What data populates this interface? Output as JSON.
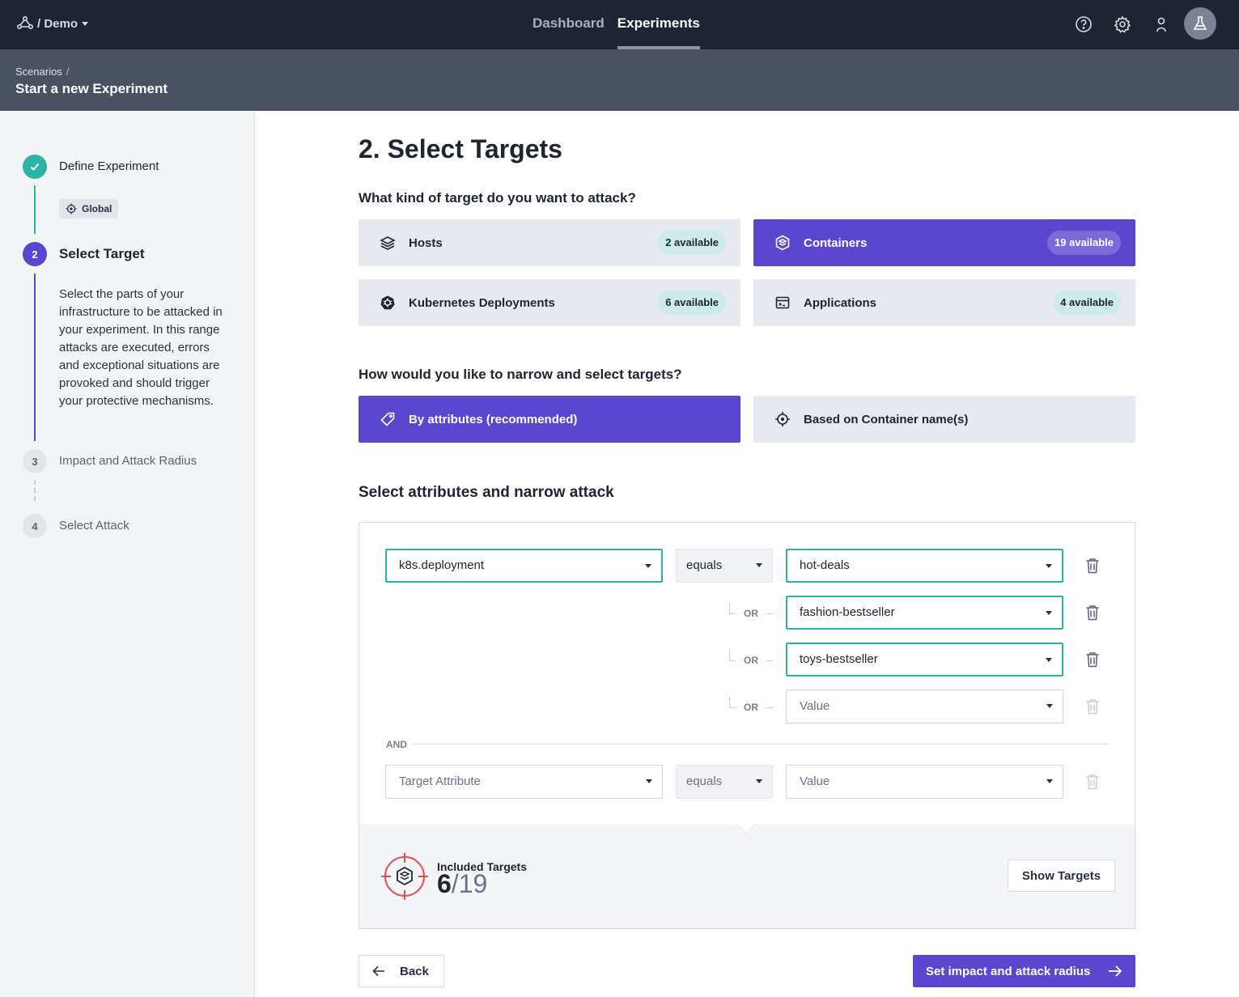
{
  "header": {
    "workspace": "/ Demo",
    "nav": [
      {
        "label": "Dashboard",
        "active": false
      },
      {
        "label": "Experiments",
        "active": true
      }
    ],
    "icons": [
      "help-icon",
      "settings-icon",
      "user-icon",
      "flask-icon"
    ]
  },
  "subheader": {
    "breadcrumb": "Scenarios",
    "breadcrumb_sep": "/",
    "title": "Start a new Experiment"
  },
  "sidebar": {
    "steps": [
      {
        "number": "",
        "label": "Define Experiment",
        "state": "done"
      },
      {
        "number": "2",
        "label": "Select Target",
        "state": "active"
      },
      {
        "number": "3",
        "label": "Impact and Attack Radius",
        "state": "pending"
      },
      {
        "number": "4",
        "label": "Select Attack",
        "state": "pending"
      }
    ],
    "global_tag": "Global",
    "description": "Select the parts of your infrastructure to be attacked in your experiment. In this range attacks are executed, errors and exceptional situations are provoked and should trigger your protective mechanisms."
  },
  "main": {
    "title": "2. Select Targets",
    "target_question": "What kind of target do you want to attack?",
    "target_types": [
      {
        "label": "Hosts",
        "badge": "2 available",
        "icon": "layers-icon",
        "selected": false
      },
      {
        "label": "Containers",
        "badge": "19 available",
        "icon": "container-icon",
        "selected": true
      },
      {
        "label": "Kubernetes Deployments",
        "badge": "6 available",
        "icon": "kubernetes-icon",
        "selected": false
      },
      {
        "label": "Applications",
        "badge": "4 available",
        "icon": "application-icon",
        "selected": false
      }
    ],
    "narrow_question": "How would you like to narrow and select targets?",
    "narrow_options": [
      {
        "label": "By attributes (recommended)",
        "icon": "tag-icon",
        "selected": true
      },
      {
        "label": "Based on Container name(s)",
        "icon": "crosshair-icon",
        "selected": false
      }
    ],
    "attributes_heading": "Select attributes and narrow attack",
    "conditions": {
      "first_attribute": "k8s.deployment",
      "first_operator": "equals",
      "values": [
        "hot-deals",
        "fashion-bestseller",
        "toys-bestseller"
      ],
      "value_placeholder": "Value",
      "or_label": "OR",
      "and_label": "AND",
      "second_attribute_placeholder": "Target Attribute",
      "second_operator": "equals",
      "second_value_placeholder": "Value"
    },
    "results": {
      "label": "Included Targets",
      "count": "6",
      "total": "/19",
      "show_button": "Show Targets"
    },
    "back_button": "Back",
    "next_button": "Set impact and attack radius"
  },
  "colors": {
    "accent": "#5b46cf",
    "teal": "#2bb3a6",
    "topbar": "#1e2431",
    "subheader": "#4a5261"
  }
}
